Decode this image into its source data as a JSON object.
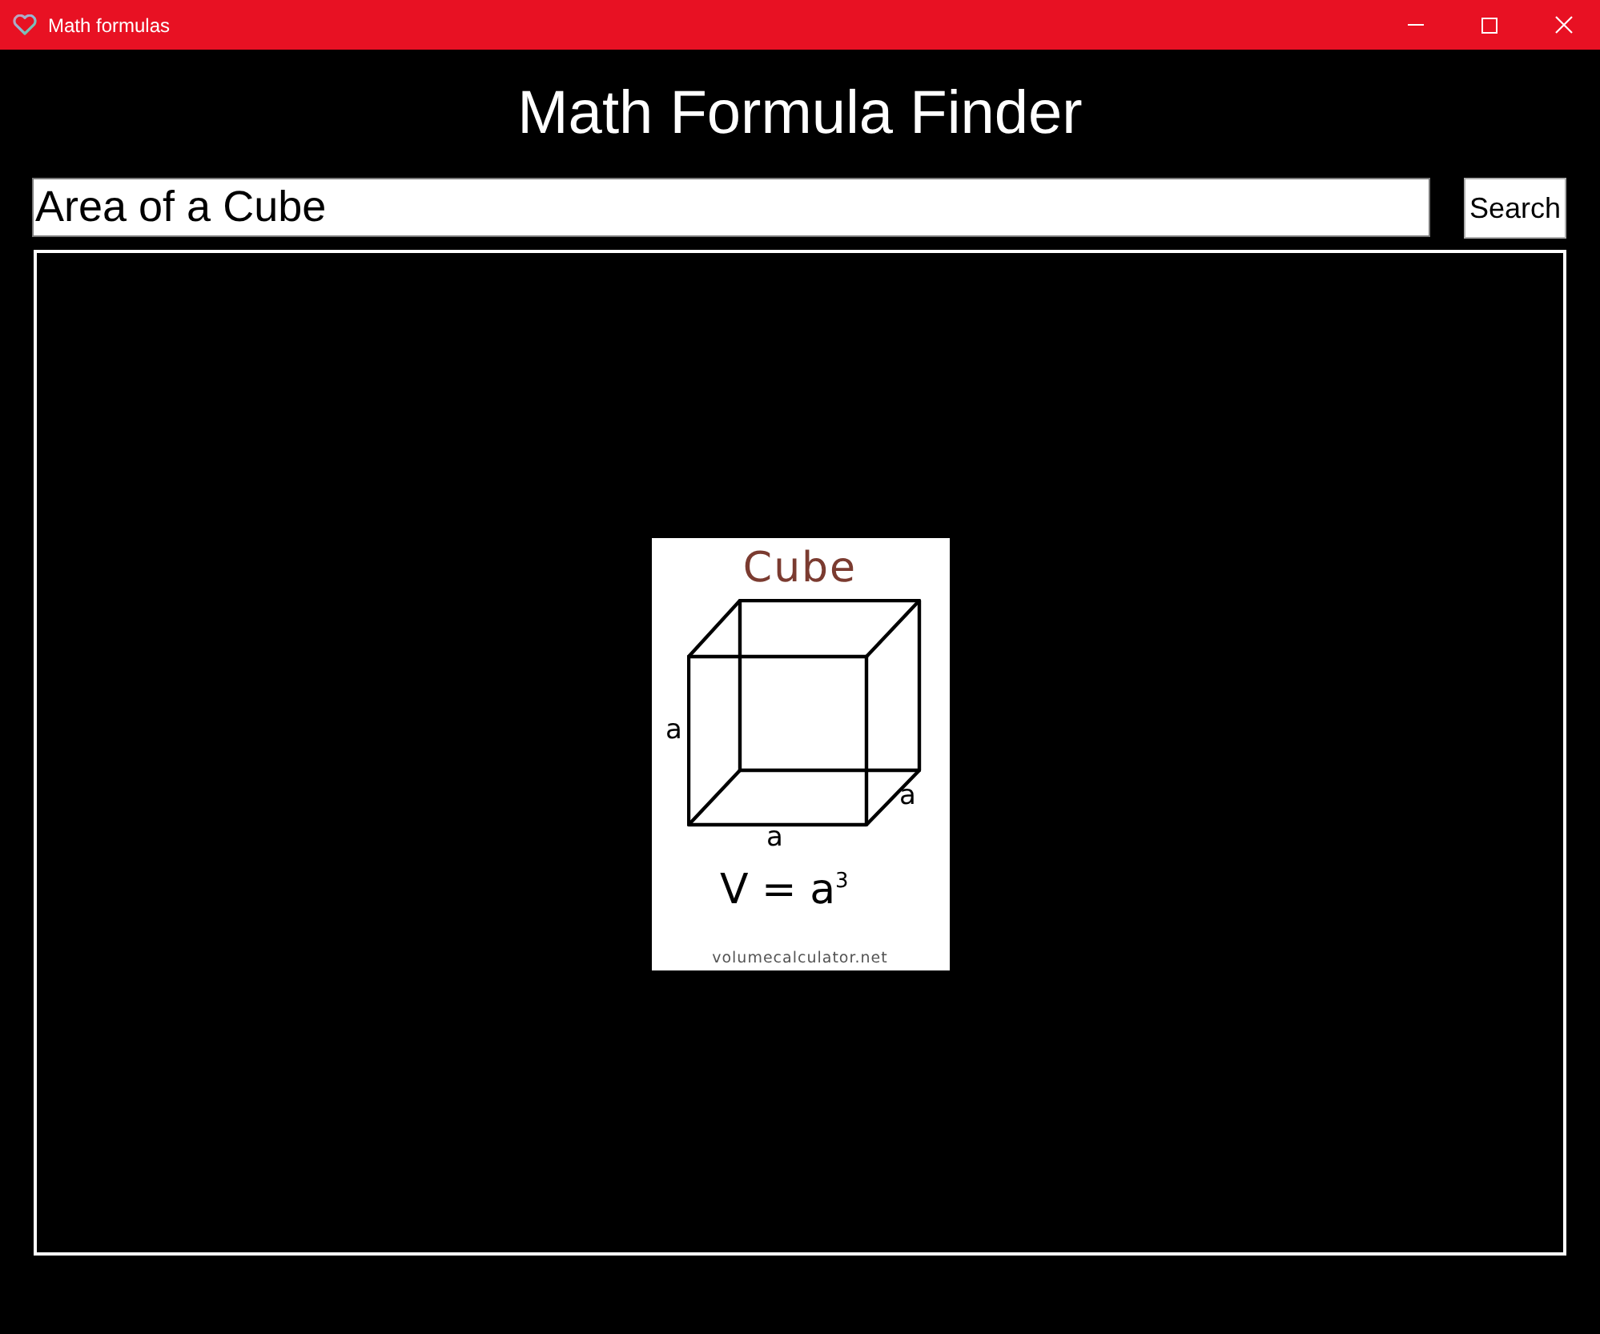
{
  "window": {
    "title": "Math formulas"
  },
  "heading": "Math Formula Finder",
  "search": {
    "value": "Area of a Cube",
    "button": "Search"
  },
  "result": {
    "image": {
      "title": "Cube",
      "edge_labels": [
        "a",
        "a",
        "a"
      ],
      "formula": "V = a$^{3}$",
      "credit": "volumecalculator.net"
    }
  }
}
